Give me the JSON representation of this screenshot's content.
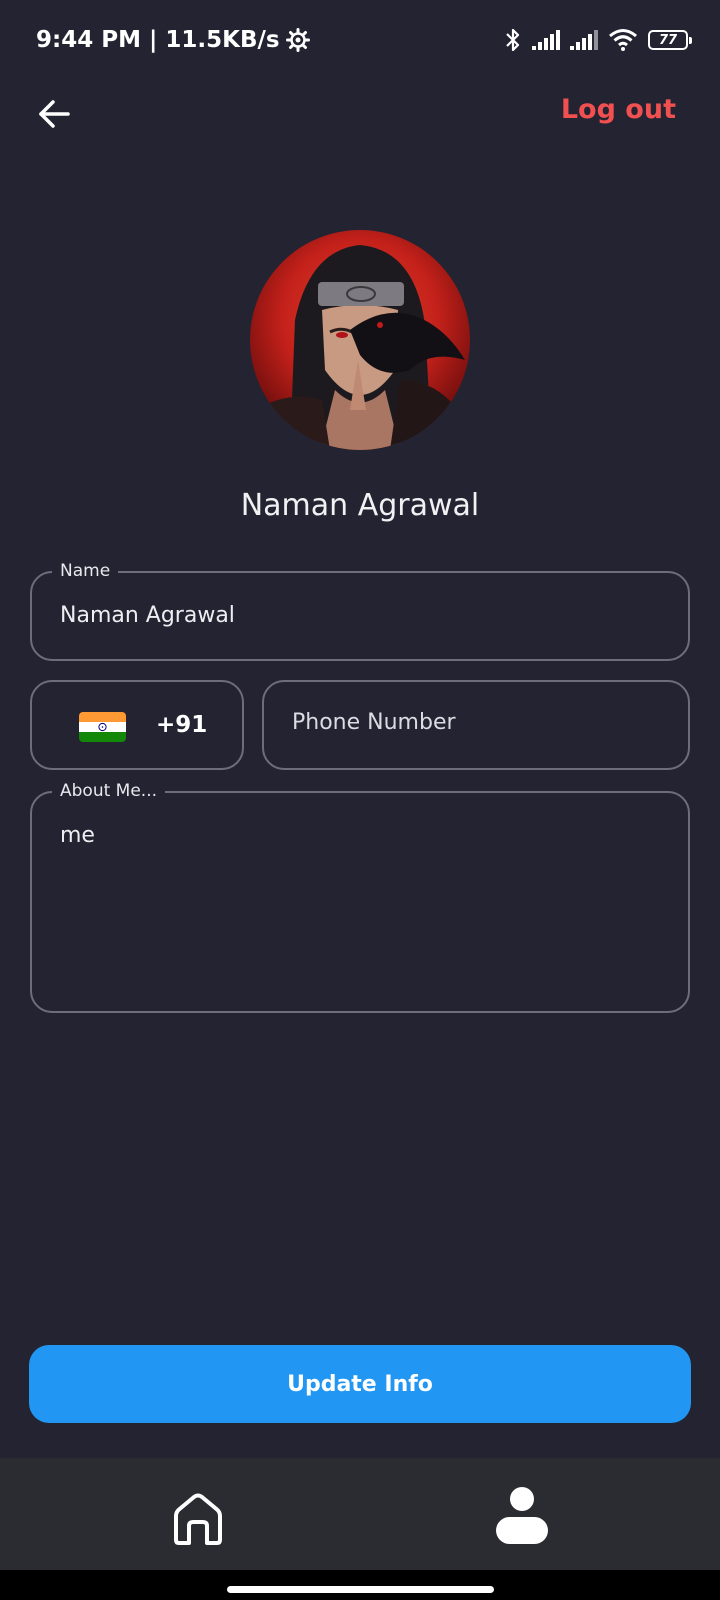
{
  "status_bar": {
    "time_speed": "9:44 PM | 11.5KB/s",
    "battery": "77",
    "icons": [
      "gear-icon",
      "bluetooth-icon",
      "signal-icon",
      "signal-icon",
      "wifi-icon",
      "battery-icon"
    ]
  },
  "header": {
    "back_icon": "arrow-left-icon",
    "logout_label": "Log out",
    "logout_color": "#f0504f"
  },
  "profile": {
    "display_name": "Naman Agrawal"
  },
  "form": {
    "name_label": "Name",
    "name_value": "Naman Agrawal",
    "country_code": "+91",
    "country_flag": "india-flag-icon",
    "phone_placeholder": "Phone Number",
    "about_label": "About Me...",
    "about_value": "me"
  },
  "actions": {
    "update_label": "Update Info",
    "update_color": "#2196f3"
  },
  "bottom_nav": {
    "items": [
      "home-icon",
      "profile-icon"
    ]
  },
  "colors": {
    "background": "#242331",
    "nav_background": "#2b2b32",
    "field_border": "#6e6d79"
  }
}
